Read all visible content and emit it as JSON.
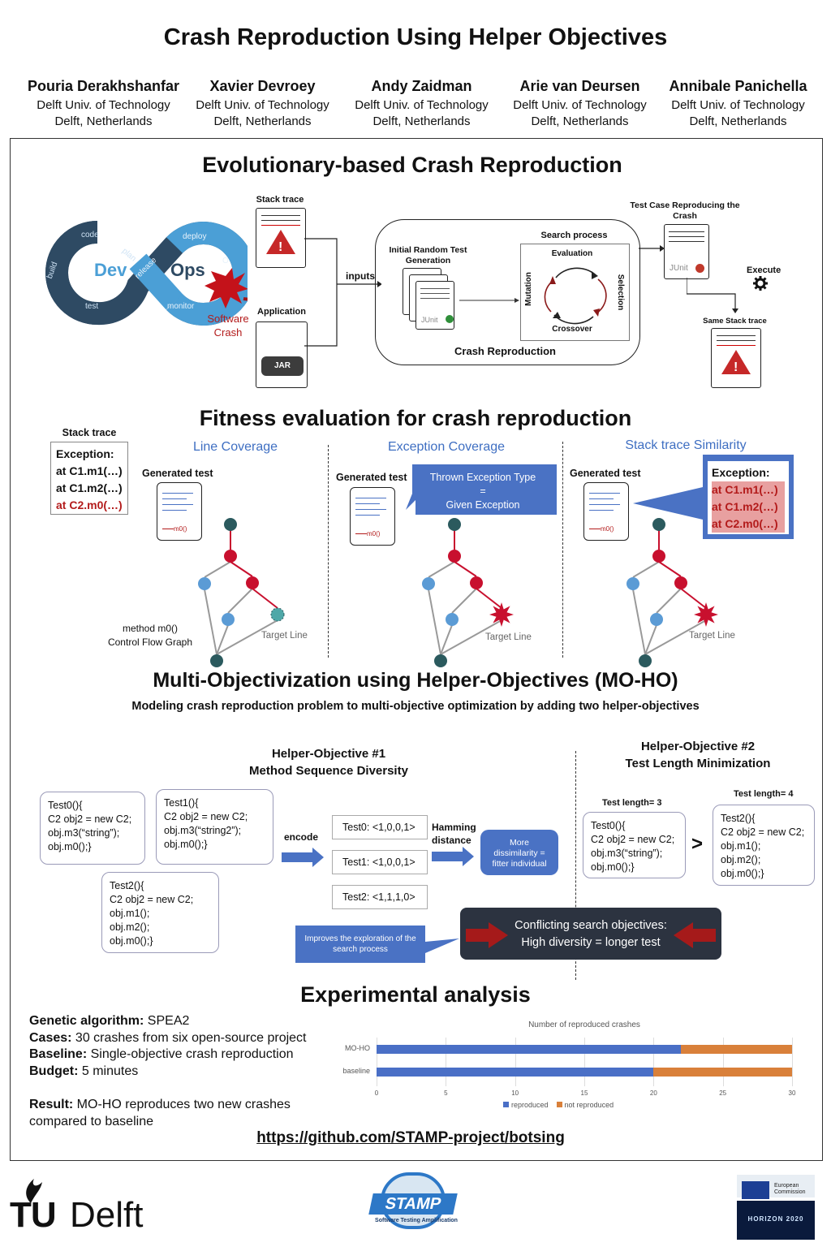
{
  "header": {
    "title": "Crash Reproduction Using Helper Objectives",
    "authors": [
      {
        "name": "Pouria Derakhshanfar",
        "affiliation": "Delft Univ. of Technology",
        "location": "Delft, Netherlands"
      },
      {
        "name": "Xavier Devroey",
        "affiliation": "Delft Univ. of Technology",
        "location": "Delft, Netherlands"
      },
      {
        "name": "Andy Zaidman",
        "affiliation": "Delft Univ. of Technology",
        "location": "Delft, Netherlands"
      },
      {
        "name": "Arie van Deursen",
        "affiliation": "Delft Univ. of Technology",
        "location": "Delft, Netherlands"
      },
      {
        "name": "Annibale Panichella",
        "affiliation": "Delft Univ. of Technology",
        "location": "Delft, Netherlands"
      }
    ]
  },
  "section1": {
    "title": "Evolutionary-based Crash Reproduction",
    "devops": {
      "dev": "Dev",
      "ops": "Ops",
      "code": "code",
      "build": "build",
      "test": "test",
      "plan": "plan",
      "release": "release",
      "deploy": "deploy",
      "operate": "O",
      "monitor": "monitor"
    },
    "software_crash": "Software Crash",
    "stack_trace": "Stack trace",
    "application": "Application",
    "jar": "JAR",
    "inputs": "inputs",
    "initial_gen": "Initial Random Test Generation",
    "junit": "JUnit",
    "search_process": "Search process",
    "evaluation": "Evaluation",
    "selection": "Selection",
    "crossover": "Crossover",
    "mutation": "Mutation",
    "crash_reproduction": "Crash Reproduction",
    "test_case_reproducing": "Test Case Reproducing the Crash",
    "execute": "Execute",
    "same_stack_trace": "Same Stack trace",
    "warning": "!"
  },
  "section2": {
    "title": "Fitness evaluation for crash reproduction",
    "stack_trace_label": "Stack trace",
    "exception": "Exception:",
    "frames": [
      "at C1.m1(…)",
      "at C1.m2(…)",
      "at C2.m0(…)"
    ],
    "line_coverage": "Line Coverage",
    "exception_coverage": "Exception Coverage",
    "stack_similarity": "Stack trace Similarity",
    "generated_test": "Generated test",
    "m0": "m0()",
    "thrown_exception": "Thrown Exception Type",
    "equals": "=",
    "given_exception": "Given Exception",
    "method_cfg": "method m0()",
    "control_flow": "Control Flow Graph",
    "target_line": "Target Line"
  },
  "section3": {
    "title": "Multi-Objectivization using Helper-Objectives (MO-HO)",
    "subtitle": "Modeling crash reproduction problem to multi-objective optimization by adding two helper-objectives",
    "ho1_title": "Helper-Objective #1",
    "ho1_sub": "Method Sequence Diversity",
    "ho2_title": "Helper-Objective #2",
    "ho2_sub": "Test Length Minimization",
    "test0": [
      "Test0(){",
      "C2 obj2 = new C2;",
      "obj.m3(“string”);",
      "obj.m0();}"
    ],
    "test1": [
      "Test1(){",
      "C2 obj2 = new C2;",
      "obj.m3(“string2”);",
      "obj.m0();}"
    ],
    "test2": [
      "Test2(){",
      "C2 obj2 = new C2;",
      "obj.m1();",
      "obj.m2();",
      "obj.m0();}"
    ],
    "encode": "encode",
    "encodings": [
      "Test0: <1,0,0,1>",
      "Test1: <1,0,0,1>",
      "Test2: <1,1,1,0>"
    ],
    "hamming": "Hamming distance",
    "dissimilarity": "More dissimilarity = fitter individual",
    "improves": "Improves the exploration of the search process",
    "conflict_1": "Conflicting search objectives:",
    "conflict_2": "High diversity = longer test",
    "test_length_3": "Test length= 3",
    "test_length_4": "Test length= 4",
    "greater": ">"
  },
  "section4": {
    "title": "Experimental analysis",
    "items": [
      {
        "label": "Genetic algorithm:",
        "value": " SPEA2"
      },
      {
        "label": "Cases:",
        "value": " 30 crashes from six open-source project"
      },
      {
        "label": "Baseline:",
        "value": " Single-objective crash reproduction"
      },
      {
        "label": "Budget:",
        "value": " 5 minutes"
      }
    ],
    "result_label": "Result:",
    "result_value": " MO-HO reproduces two new crashes compared to baseline",
    "link": "https://github.com/STAMP-project/botsing"
  },
  "chart_data": {
    "type": "bar",
    "orientation": "horizontal",
    "stacked": true,
    "title": "Number of reproduced crashes",
    "categories": [
      "MO-HO",
      "baseline"
    ],
    "series": [
      {
        "name": "reproduced",
        "values": [
          22,
          20
        ],
        "color": "#4a6fc6"
      },
      {
        "name": "not reproduced",
        "values": [
          8,
          10
        ],
        "color": "#d9803a"
      }
    ],
    "xlim": [
      0,
      30
    ],
    "xticks": [
      "0",
      "5",
      "10",
      "15",
      "20",
      "25",
      "30"
    ],
    "grid": true,
    "legend": "bottom"
  },
  "footer": {
    "tu": "TU",
    "delft": "Delft",
    "stamp": "STAMP",
    "stamp_sub": "Software Testing Amplification",
    "eu": "European Commission",
    "horizon": "HORIZON 2020"
  }
}
